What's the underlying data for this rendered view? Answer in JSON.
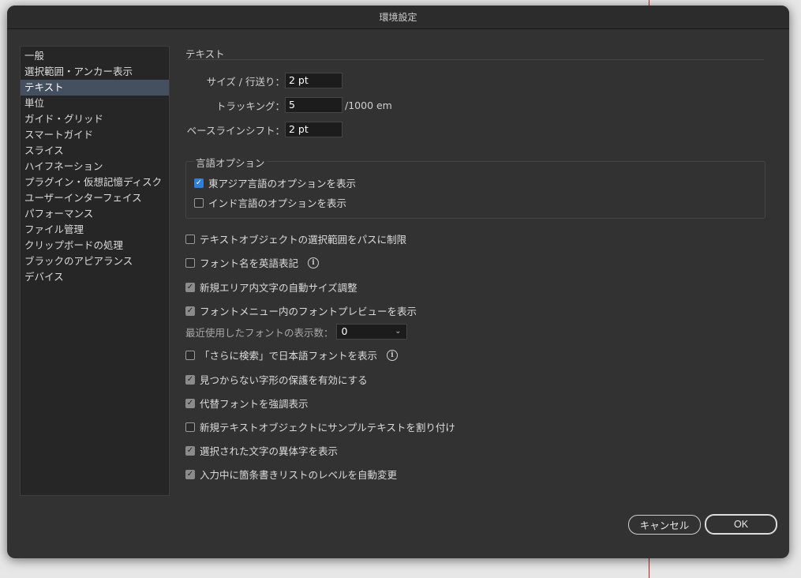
{
  "window": {
    "title": "環境設定"
  },
  "sidebar": {
    "items": [
      {
        "label": "一般"
      },
      {
        "label": "選択範囲・アンカー表示"
      },
      {
        "label": "テキスト",
        "selected": true
      },
      {
        "label": "単位"
      },
      {
        "label": "ガイド・グリッド"
      },
      {
        "label": "スマートガイド"
      },
      {
        "label": "スライス"
      },
      {
        "label": "ハイフネーション"
      },
      {
        "label": "プラグイン・仮想記憶ディスク"
      },
      {
        "label": "ユーザーインターフェイス"
      },
      {
        "label": "パフォーマンス"
      },
      {
        "label": "ファイル管理"
      },
      {
        "label": "クリップボードの処理"
      },
      {
        "label": "ブラックのアピアランス"
      },
      {
        "label": "デバイス"
      }
    ]
  },
  "text_section": {
    "title": "テキスト",
    "size_leading": {
      "label": "サイズ / 行送り：",
      "value": "2 pt"
    },
    "tracking": {
      "label": "トラッキング：",
      "value": "5",
      "unit": "/1000 em"
    },
    "baseline_shift": {
      "label": "ベースラインシフト：",
      "value": "2 pt"
    }
  },
  "language_options": {
    "title": "言語オプション",
    "east_asian": {
      "label": "東アジア言語のオプションを表示",
      "checked": true
    },
    "indic": {
      "label": "インド言語のオプションを表示",
      "checked": false
    }
  },
  "options": {
    "limit_selection_to_path": {
      "label": "テキストオブジェクトの選択範囲をパスに制限",
      "checked": false
    },
    "font_names_english": {
      "label": "フォント名を英語表記",
      "checked": false
    },
    "auto_size_area_type": {
      "label": "新規エリア内文字の自動サイズ調整",
      "checked": true
    },
    "font_preview": {
      "label": "フォントメニュー内のフォントプレビューを表示",
      "checked": true
    },
    "recent_fonts": {
      "label": "最近使用したフォントの表示数：",
      "value": "0"
    },
    "find_more_japanese": {
      "label": "「さらに検索」で日本語フォントを表示",
      "checked": false
    },
    "protect_missing_glyphs": {
      "label": "見つからない字形の保護を有効にする",
      "checked": true
    },
    "highlight_substituted": {
      "label": "代替フォントを強調表示",
      "checked": true
    },
    "fill_placeholder": {
      "label": "新規テキストオブジェクトにサンプルテキストを割り付け",
      "checked": false
    },
    "show_alternates": {
      "label": "選択された文字の異体字を表示",
      "checked": true
    },
    "auto_list_level": {
      "label": "入力中に箇条書きリストのレベルを自動変更",
      "checked": true
    }
  },
  "buttons": {
    "cancel": "キャンセル",
    "ok": "OK"
  },
  "icons": {
    "check": "✓",
    "info": "i",
    "chevron": "⌄"
  }
}
